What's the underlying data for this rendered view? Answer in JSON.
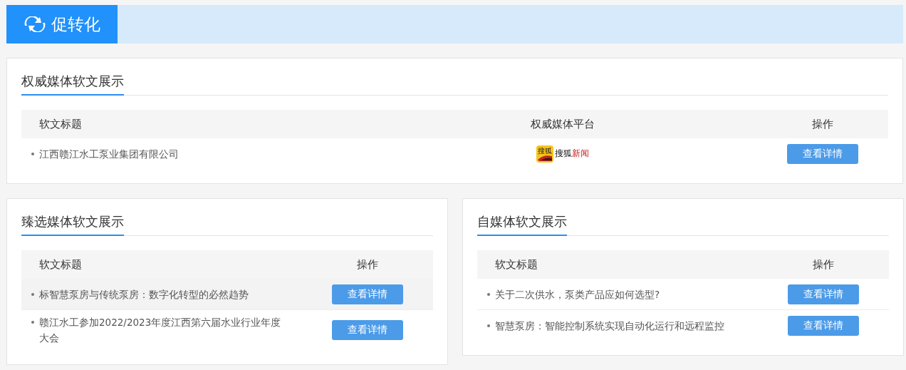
{
  "header": {
    "title": "促转化"
  },
  "authority": {
    "title": "权威媒体软文展示",
    "columns": [
      "软文标题",
      "权威媒体平台",
      "操作"
    ],
    "rows": [
      {
        "title": "江西赣江水工泵业集团有限公司",
        "platform": {
          "icon_text": "搜狐",
          "brand": "搜狐",
          "suffix": "新闻"
        },
        "action": "查看详情",
        "highlighted": false
      }
    ]
  },
  "panels": [
    {
      "title": "臻选媒体软文展示",
      "columns": [
        "软文标题",
        "操作"
      ],
      "rows": [
        {
          "title": "标智慧泵房与传统泵房：数字化转型的必然趋势",
          "action": "查看详情",
          "highlighted": true
        },
        {
          "title": "赣江水工参加2022/2023年度江西第六届水业行业年度大会",
          "action": "查看详情",
          "highlighted": false
        }
      ]
    },
    {
      "title": "自媒体软文展示",
      "columns": [
        "软文标题",
        "操作"
      ],
      "rows": [
        {
          "title": "关于二次供水，泵类产品应如何选型?",
          "action": "查看详情",
          "highlighted": false
        },
        {
          "title": "智慧泵房：智能控制系统实现自动化运行和远程监控",
          "action": "查看详情",
          "highlighted": false
        }
      ]
    }
  ]
}
